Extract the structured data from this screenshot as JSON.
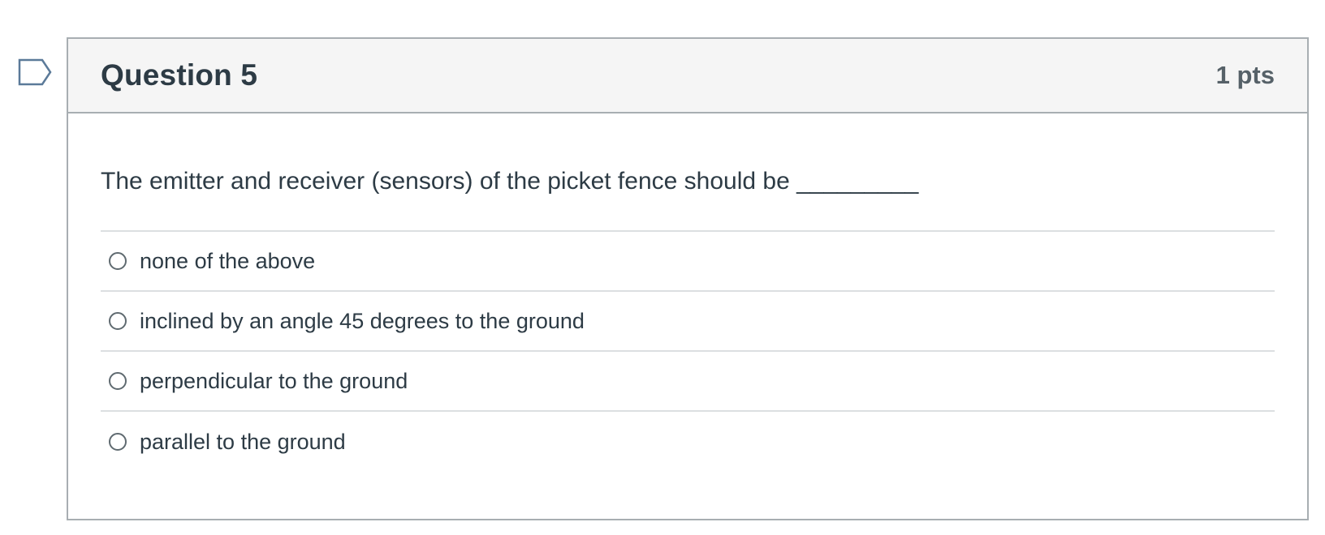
{
  "question": {
    "title": "Question 5",
    "points": "1 pts",
    "text": "The emitter and receiver (sensors) of the picket fence should be _________",
    "flag_icon": "flag-bookmark-icon",
    "answers": [
      {
        "label": "none of the above",
        "selected": false
      },
      {
        "label": "inclined by an angle 45 degrees to the ground",
        "selected": false
      },
      {
        "label": "perpendicular to the ground",
        "selected": false
      },
      {
        "label": "parallel to the ground",
        "selected": false
      }
    ]
  },
  "colors": {
    "text": "#2d3b45",
    "border": "#a8aeb2",
    "header_bg": "#f5f5f5",
    "divider": "#dcdfe1",
    "flag": "#5b7a99"
  }
}
